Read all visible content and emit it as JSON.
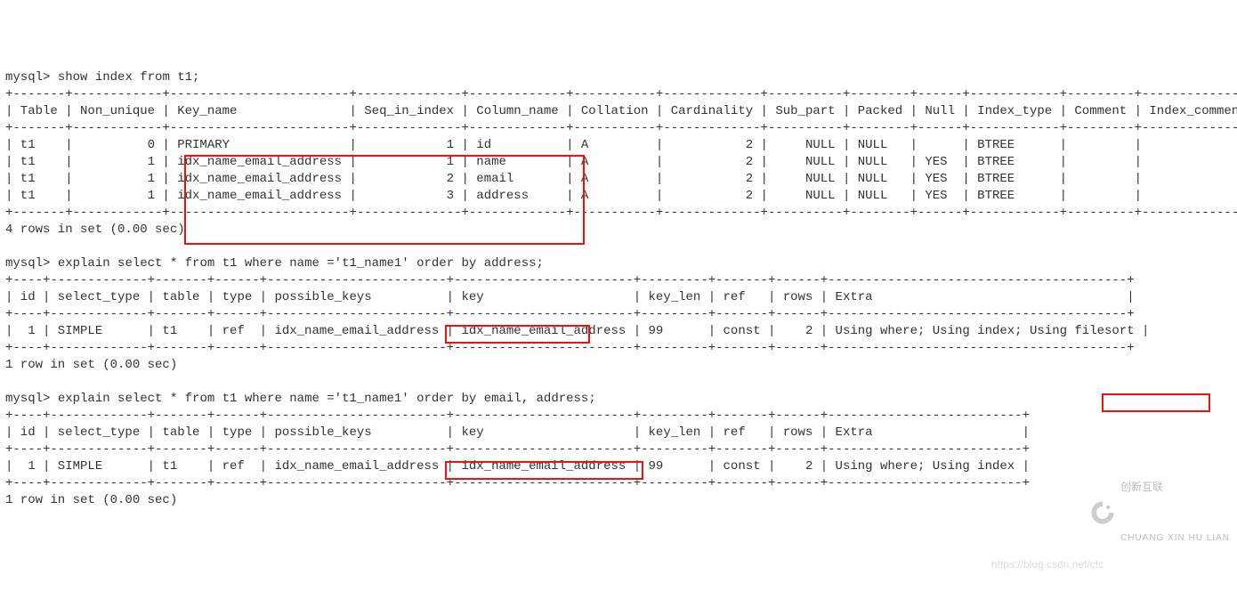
{
  "prompt": "mysql>",
  "query1": "show index from t1;",
  "sep_long": "+-------+------------+------------------------+--------------+-------------+-----------+-------------+----------+--------+------+------------+---------+---------------+",
  "hdr1_l1": "| Table | Non_unique | Key_name               | Seq_in_index | Column_name | Collation | Cardinality | Sub_part | Packed | Null | Index_type | Comment | Index_comment |",
  "rows1": [
    "| t1    |          0 | PRIMARY                |            1 | id          | A         |           2 |     NULL | NULL   |      | BTREE      |         |               |",
    "| t1    |          1 | idx_name_email_address |            1 | name        | A         |           2 |     NULL | NULL   | YES  | BTREE      |         |               |",
    "| t1    |          1 | idx_name_email_address |            2 | email       | A         |           2 |     NULL | NULL   | YES  | BTREE      |         |               |",
    "| t1    |          1 | idx_name_email_address |            3 | address     | A         |           2 |     NULL | NULL   | YES  | BTREE      |         |               |"
  ],
  "result1": "4 rows in set (0.00 sec)",
  "query2_a": "explain select * from t1 where name ='t1_name1' ",
  "query2_b": "order by address;",
  "sep2": "+----+-------------+-------+------+------------------------+------------------------+---------+-------+------+----------------------------------------+",
  "hdr2": "| id | select_type | table | type | possible_keys          | key                    | key_len | ref   | rows | Extra                                  |",
  "row2_a": "|  1 | SIMPLE      | t1    | ref  | idx_name_email_address | idx_name_email_address | 99      | const |    2 | Using where; Using index; ",
  "row2_b": "Using filesort",
  "row2_c": " |",
  "result2": "1 row in set (0.00 sec)",
  "query3_a": "explain select * from t1 where name ='t1_name1' ",
  "query3_b": "order by email, address;",
  "sep3": "+----+-------------+-------+------+------------------------+------------------------+---------+-------+------+--------------------------+",
  "hdr3": "| id | select_type | table | type | possible_keys          | key                    | key_len | ref   | rows | Extra                    |",
  "row3": "|  1 | SIMPLE      | t1    | ref  | idx_name_email_address | idx_name_email_address | 99      | const |    2 | Using where; Using index |",
  "result3": "1 row in set (0.00 sec)",
  "wm_url": "https://blog.csdn.net/ctc",
  "wm_brand": "创新互联",
  "wm_sub": "CHUANG XIN HU LIAN"
}
